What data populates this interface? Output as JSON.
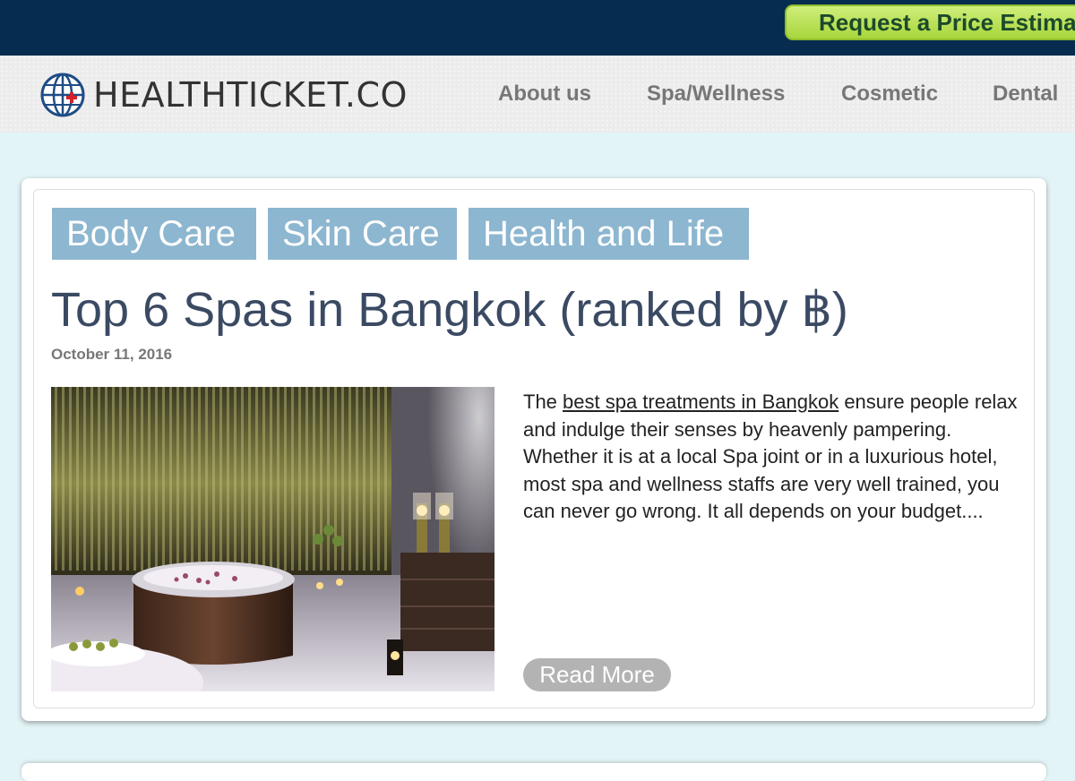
{
  "topbar": {
    "estimate_label": "Request a Price Estima"
  },
  "header": {
    "logo_text": "HEALTHTICKET.CO",
    "nav": [
      "About us",
      "Spa/Wellness",
      "Cosmetic",
      "Dental"
    ]
  },
  "post": {
    "tags": [
      "Body Care",
      "Skin Care",
      "Health and Life"
    ],
    "title": "Top 6 Spas in Bangkok (ranked by ฿)",
    "date": "October 11, 2016",
    "excerpt_lead": "The ",
    "excerpt_link": "best spa treatments in Bangkok",
    "excerpt_rest": " ensure people relax and indulge their senses by heavenly pampering. Whether it is at a local Spa joint or in a luxurious hotel, most spa and wellness staffs are very well trained, you can never go wrong. It all depends on your budget....",
    "read_more": "Read More"
  },
  "colors": {
    "topbar": "#062c4f",
    "tag": "#8db6d0",
    "title": "#3b4a63",
    "page_bg": "#e3f4f7",
    "button": "#b3b3b3"
  }
}
